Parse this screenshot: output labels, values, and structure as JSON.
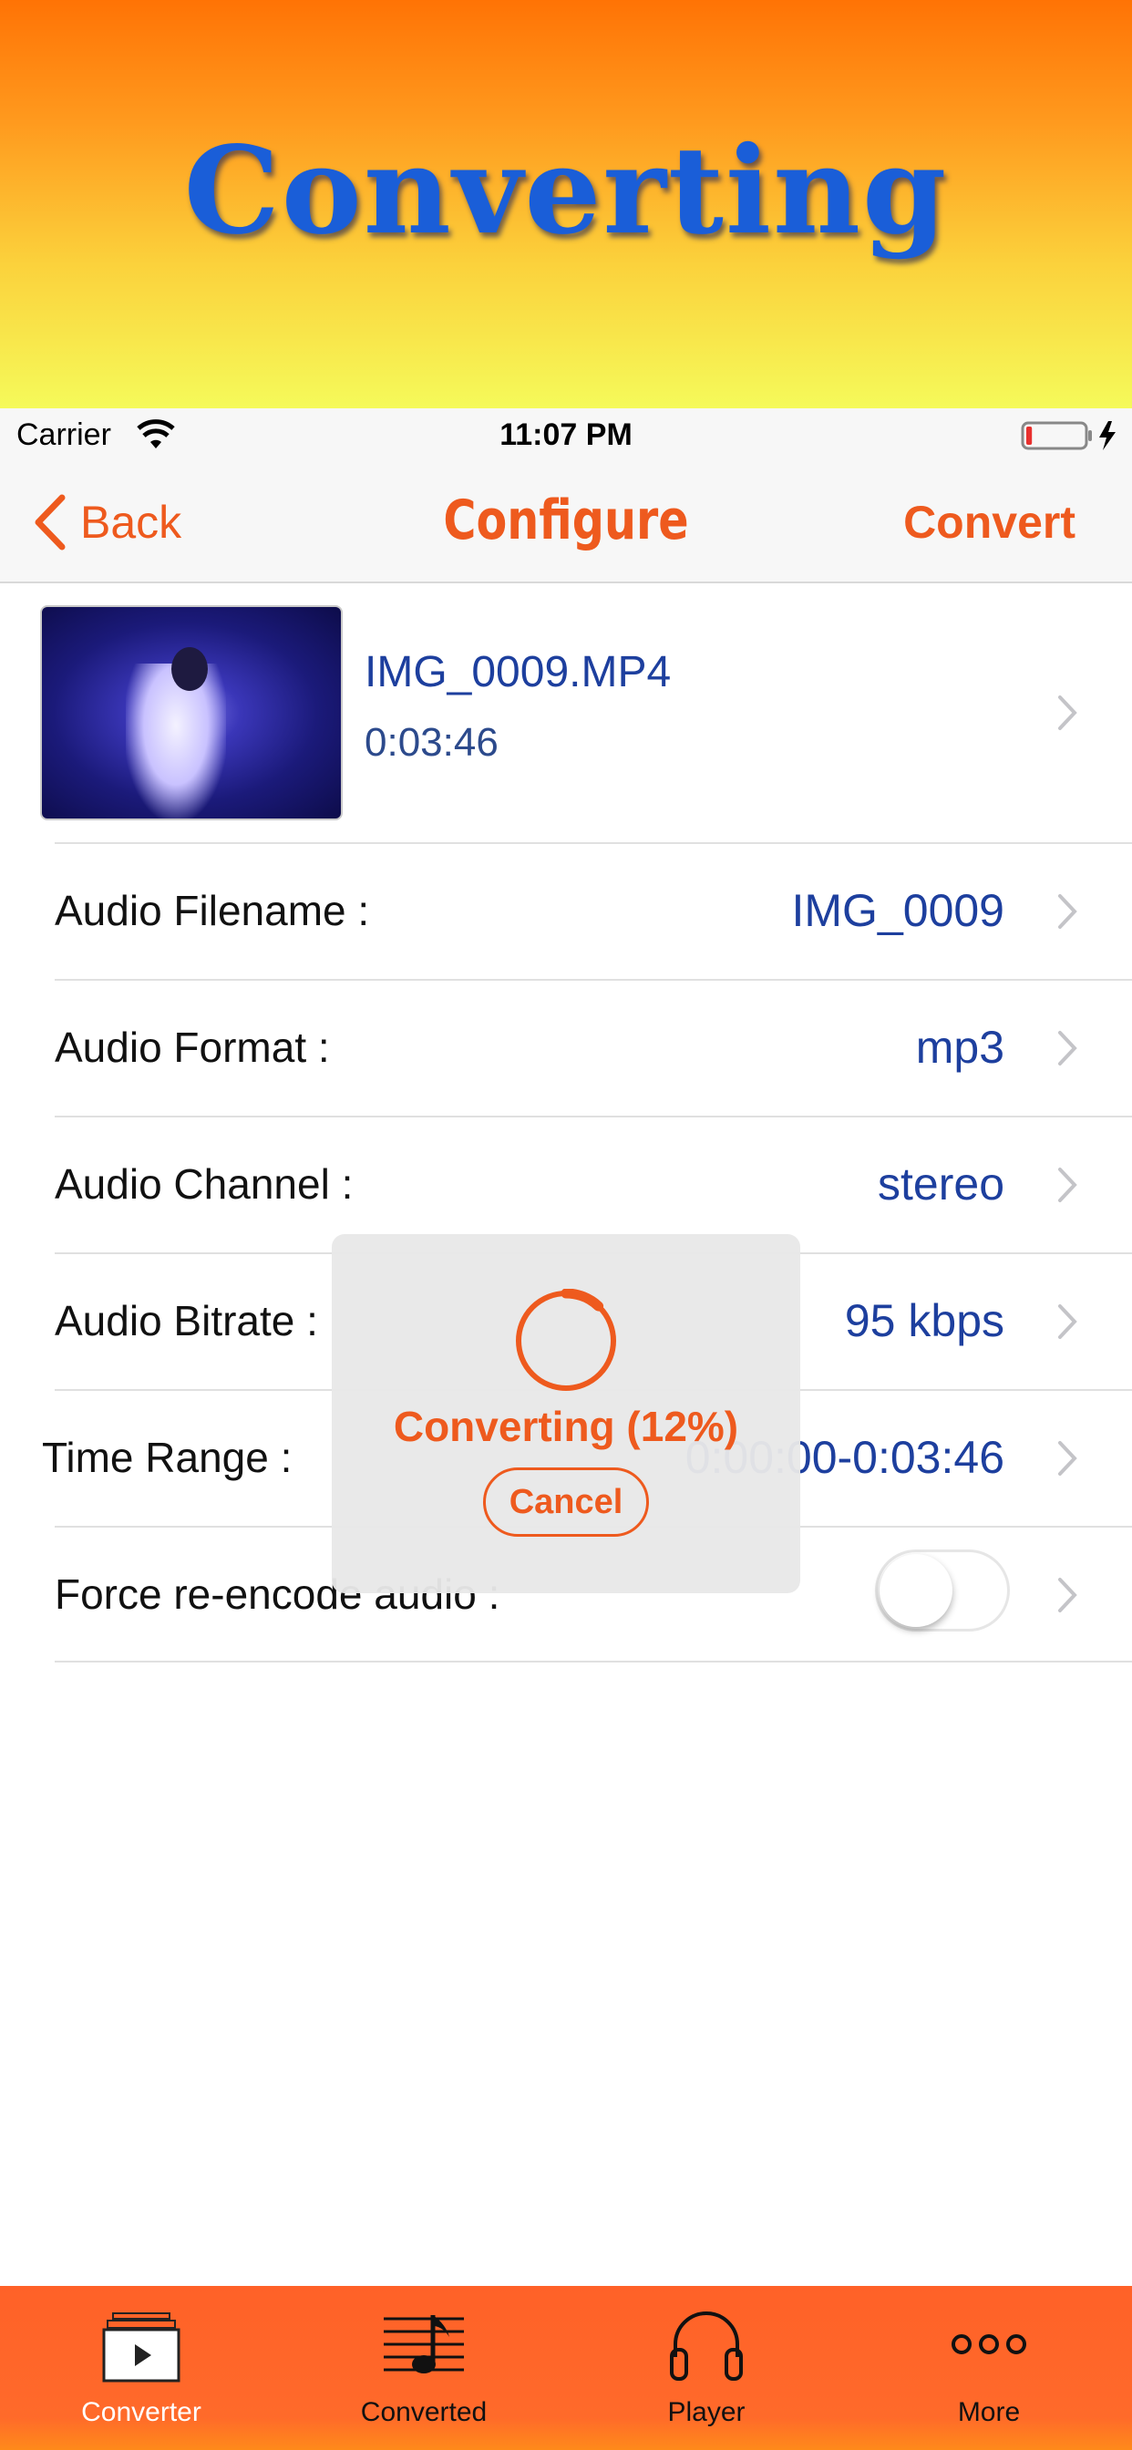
{
  "banner": {
    "title": "Converting"
  },
  "status_bar": {
    "carrier": "Carrier",
    "time": "11:07 PM",
    "battery_level": 0.1
  },
  "nav": {
    "back_label": "Back",
    "title": "Configure",
    "action_label": "Convert"
  },
  "file": {
    "name": "IMG_0009.MP4",
    "duration": "0:03:46"
  },
  "settings": [
    {
      "label": "Audio Filename :",
      "value": "IMG_0009"
    },
    {
      "label": "Audio Format :",
      "value": "mp3"
    },
    {
      "label": "Audio Channel :",
      "value": "stereo"
    },
    {
      "label": "Audio Bitrate :",
      "value": "95 kbps"
    },
    {
      "label": "Time Range :",
      "value": "0:00:00-0:03:46"
    },
    {
      "label": "Force re-encode audio :",
      "value": ""
    }
  ],
  "force_reencode_on": false,
  "hud": {
    "status": "Converting (12%)",
    "progress": 0.12,
    "cancel_label": "Cancel"
  },
  "tabs": [
    {
      "label": "Converter",
      "icon": "video-play-icon",
      "active": true
    },
    {
      "label": "Converted",
      "icon": "music-note-icon",
      "active": false
    },
    {
      "label": "Player",
      "icon": "headphones-icon",
      "active": false
    },
    {
      "label": "More",
      "icon": "more-dots-icon",
      "active": false
    }
  ],
  "colors": {
    "accent": "#ee5a1e",
    "value_blue": "#1d3f9e",
    "tabbar": "#ff6128",
    "banner_title": "#1a5ed8"
  }
}
